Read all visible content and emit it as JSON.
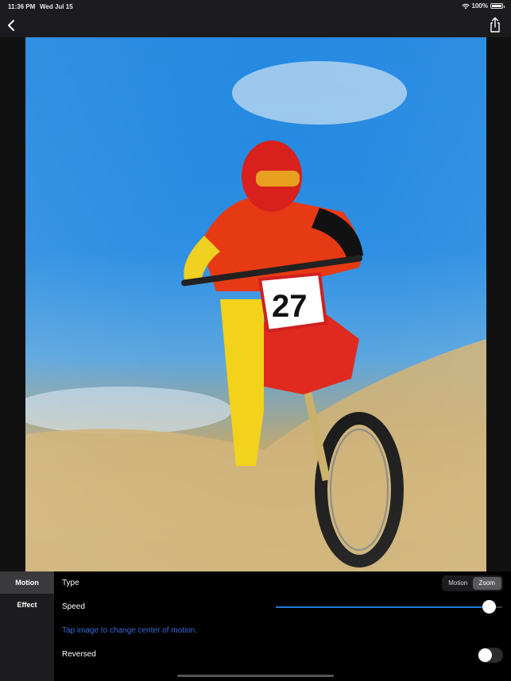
{
  "status_bar": {
    "time": "11:36 PM",
    "date": "Wed Jul 15",
    "battery": "100%"
  },
  "nav": {
    "back_icon": "chevron-left-icon",
    "share_icon": "share-icon"
  },
  "photo": {
    "description": "Motocross rider on red dirt bike number 27 with zoom motion blur",
    "bike_number": "27"
  },
  "sidebar": {
    "tabs": [
      {
        "label": "Motion",
        "active": true
      },
      {
        "label": "Effect",
        "active": false
      }
    ]
  },
  "settings": {
    "type_label": "Type",
    "type_options": [
      "Motion",
      "Zoom"
    ],
    "type_selected": "Zoom",
    "speed_label": "Speed",
    "speed_value": 0.94,
    "hint": "Tap image to change center of motion.",
    "reversed_label": "Reversed",
    "reversed_on": false
  },
  "colors": {
    "accent": "#1e7ae0",
    "hint": "#3a6bd8",
    "chrome": "#1c1c1e"
  }
}
